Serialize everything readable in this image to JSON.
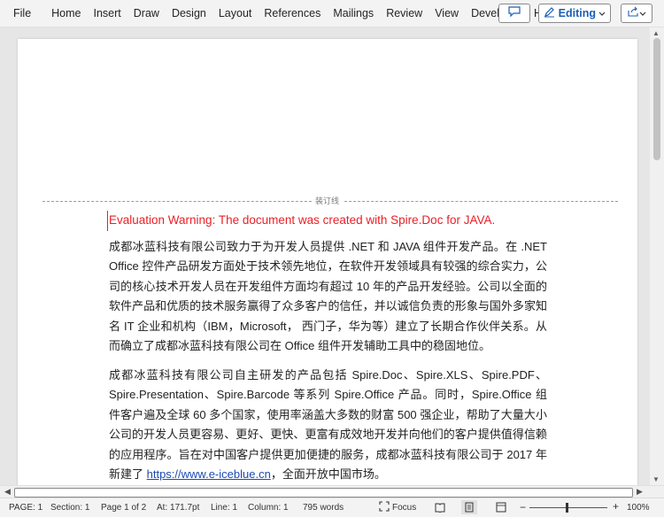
{
  "menu": {
    "items": [
      "File",
      "Home",
      "Insert",
      "Draw",
      "Design",
      "Layout",
      "References",
      "Mailings",
      "Review",
      "View",
      "Developer",
      "Help"
    ],
    "editing_label": "Editing",
    "icons": {
      "comment": "comment-icon",
      "editing": "pencil-icon",
      "share": "share-icon"
    },
    "accent_color": "#1a5fb4"
  },
  "document": {
    "binding_label": "装订线",
    "warning": "Evaluation Warning: The document was created with Spire.Doc for JAVA.",
    "warning_color": "#ea2027",
    "paragraph1": "成都冰蓝科技有限公司致力于为开发人员提供 .NET 和 JAVA 组件开发产品。在 .NET Office 控件产品研发方面处于技术领先地位，在软件开发领域具有较强的综合实力，公司的核心技术开发人员在开发组件方面均有超过 10 年的产品开发经验。公司以全面的软件产品和优质的技术服务赢得了众多客户的信任，并以诚信负责的形象与国外多家知名 IT 企业和机构（IBM，Microsoft， 西门子，华为等）建立了长期合作伙伴关系。从而确立了成都冰蓝科技有限公司在 Office 组件开发辅助工具中的稳固地位。",
    "paragraph2_before": "成都冰蓝科技有限公司自主研发的产品包括 Spire.Doc、Spire.XLS、Spire.PDF、Spire.Presentation、Spire.Barcode 等系列 Spire.Office 产品。同时，Spire.Office 组件客户遍及全球 60 多个国家，使用率涵盖大多数的财富 500 强企业，帮助了大量大小公司的开发人员更容易、更好、更快、更富有成效地开发并向他们的客户提供值得信赖的应用程序。旨在对中国客户提供更加便捷的服务，成都冰蓝科技有限公司于 2017 年新建了 ",
    "link": "https://www.e-iceblue.cn",
    "paragraph2_after": "，全面开放中国市场。"
  },
  "status": {
    "page": "PAGE: 1",
    "section": "Section: 1",
    "page_of": "Page 1 of 2",
    "at": "At: 171.7pt",
    "line": "Line: 1",
    "column": "Column: 1",
    "words": "795 words",
    "focus": "Focus",
    "zoom": "100%",
    "zoom_minus": "−",
    "zoom_plus": "+"
  }
}
